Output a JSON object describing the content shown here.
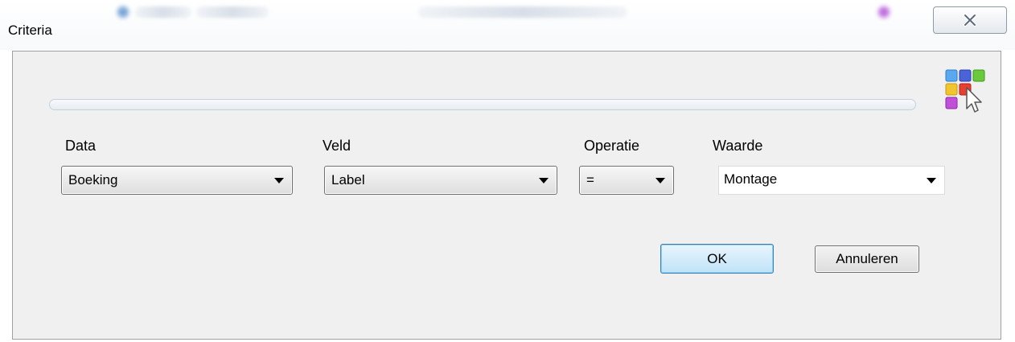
{
  "window": {
    "title": "Criteria"
  },
  "progress": {
    "value": 0
  },
  "form": {
    "labels": {
      "data": "Data",
      "veld": "Veld",
      "operatie": "Operatie",
      "waarde": "Waarde"
    },
    "data_value": "Boeking",
    "veld_value": "Label",
    "operatie_value": "=",
    "waarde_value": "Montage"
  },
  "buttons": {
    "ok": "OK",
    "annuleren": "Annuleren"
  },
  "icons": {
    "close": "close-icon",
    "app_logo": "colored-grid-cursor-logo",
    "dropdown": "chevron-down-icon"
  },
  "colors": {
    "panel_bg": "#f0f0f0",
    "ok_button": "#bfe3f7",
    "accent_blue": "#3c7fb1"
  }
}
